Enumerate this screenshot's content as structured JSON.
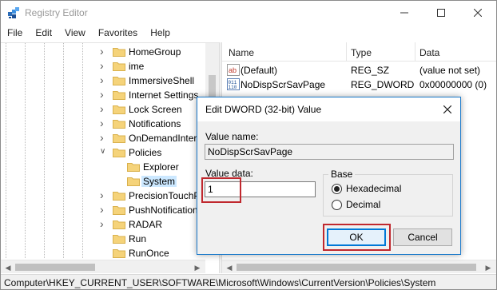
{
  "window": {
    "title": "Registry Editor",
    "icons": {
      "app": "registry-editor-icon",
      "minimize": "minimize-icon",
      "maximize": "maximize-icon",
      "close": "close-icon"
    }
  },
  "menu": [
    "File",
    "Edit",
    "View",
    "Favorites",
    "Help"
  ],
  "tree": {
    "items": [
      {
        "label": "HomeGroup",
        "level": 1,
        "expander": "collapsed",
        "selected": false
      },
      {
        "label": "ime",
        "level": 1,
        "expander": "collapsed",
        "selected": false
      },
      {
        "label": "ImmersiveShell",
        "level": 1,
        "expander": "collapsed",
        "selected": false
      },
      {
        "label": "Internet Settings",
        "level": 1,
        "expander": "collapsed",
        "selected": false
      },
      {
        "label": "Lock Screen",
        "level": 1,
        "expander": "collapsed",
        "selected": false
      },
      {
        "label": "Notifications",
        "level": 1,
        "expander": "collapsed",
        "selected": false
      },
      {
        "label": "OnDemandInter",
        "level": 1,
        "expander": "collapsed",
        "selected": false
      },
      {
        "label": "Policies",
        "level": 1,
        "expander": "expanded",
        "selected": false
      },
      {
        "label": "Explorer",
        "level": 2,
        "expander": "none",
        "selected": false
      },
      {
        "label": "System",
        "level": 2,
        "expander": "none",
        "selected": true
      },
      {
        "label": "PrecisionTouchP",
        "level": 1,
        "expander": "collapsed",
        "selected": false
      },
      {
        "label": "PushNotification",
        "level": 1,
        "expander": "collapsed",
        "selected": false
      },
      {
        "label": "RADAR",
        "level": 1,
        "expander": "collapsed",
        "selected": false
      },
      {
        "label": "Run",
        "level": 1,
        "expander": "none",
        "selected": false
      },
      {
        "label": "RunOnce",
        "level": 1,
        "expander": "none",
        "selected": false
      }
    ]
  },
  "list": {
    "headers": {
      "name": "Name",
      "type": "Type",
      "data": "Data"
    },
    "rows": [
      {
        "name": "(Default)",
        "type": "REG_SZ",
        "data": "(value not set)",
        "icon": "string-value-icon"
      },
      {
        "name": "NoDispScrSavPage",
        "type": "REG_DWORD",
        "data": "0x00000000 (0)",
        "icon": "binary-value-icon"
      }
    ]
  },
  "status": {
    "path": "Computer\\HKEY_CURRENT_USER\\SOFTWARE\\Microsoft\\Windows\\CurrentVersion\\Policies\\System"
  },
  "dialog": {
    "title": "Edit DWORD (32-bit) Value",
    "value_name_label": "Value name:",
    "value_name": "NoDispScrSavPage",
    "value_data_label": "Value data:",
    "value_data": "1",
    "base_label": "Base",
    "radios": [
      {
        "label": "Hexadecimal",
        "checked": true
      },
      {
        "label": "Decimal",
        "checked": false
      }
    ],
    "ok_label": "OK",
    "cancel_label": "Cancel"
  },
  "colors": {
    "highlight_box": "#c0282e",
    "selection": "#cce8ff",
    "dialog_border": "#1979ca",
    "folder": "#f5d37a"
  }
}
